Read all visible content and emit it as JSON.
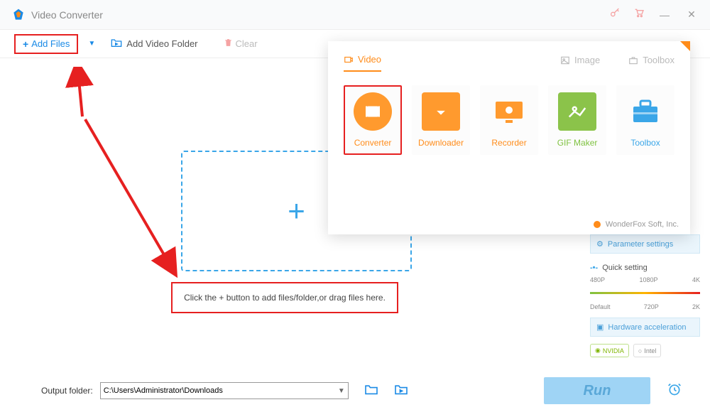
{
  "title": "Video Converter",
  "toolbar": {
    "add_files": "Add Files",
    "add_folder": "Add Video Folder",
    "clear": "Clear"
  },
  "dropzone": {
    "hint": "Click the + button to add files/folder,or drag files here."
  },
  "popup": {
    "tabs": {
      "video": "Video",
      "image": "Image",
      "toolbox": "Toolbox"
    },
    "tools": {
      "converter": "Converter",
      "downloader": "Downloader",
      "recorder": "Recorder",
      "gif": "GIF Maker",
      "toolbox": "Toolbox"
    },
    "footer": "WonderFox Soft, Inc."
  },
  "sidebar": {
    "param": "Parameter settings",
    "quick": "Quick setting",
    "ticks_top": [
      "480P",
      "1080P",
      "4K"
    ],
    "ticks_bot": [
      "Default",
      "720P",
      "2K"
    ],
    "hw": "Hardware acceleration",
    "nvidia": "NVIDIA",
    "intel": "Intel"
  },
  "bottom": {
    "label": "Output folder:",
    "path": "C:\\Users\\Administrator\\Downloads",
    "run": "Run"
  }
}
